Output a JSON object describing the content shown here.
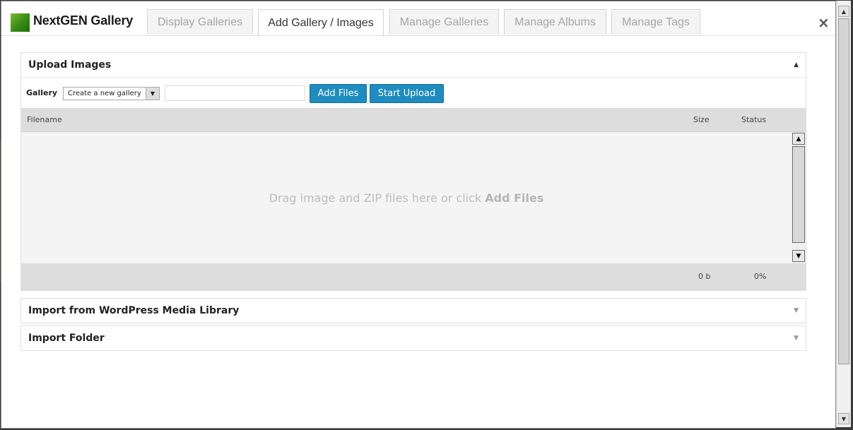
{
  "header": {
    "logo_text": "NextGEN Gallery",
    "close_glyph": "×",
    "tabs": [
      {
        "label": "Display Galleries",
        "active": false
      },
      {
        "label": "Add Gallery / Images",
        "active": true
      },
      {
        "label": "Manage Galleries",
        "active": false
      },
      {
        "label": "Manage Albums",
        "active": false
      },
      {
        "label": "Manage Tags",
        "active": false
      }
    ]
  },
  "upload": {
    "title": "Upload Images",
    "gallery_label": "Gallery",
    "gallery_select_value": "Create a new gallery",
    "gallery_name_value": "",
    "add_files_label": "Add Files",
    "start_upload_label": "Start Upload",
    "columns": {
      "filename": "Filename",
      "size": "Size",
      "status": "Status"
    },
    "drop_text": "Drag image and ZIP files here or click ",
    "drop_text_bold": "Add Files",
    "total_size": "0 b",
    "total_percent": "0%"
  },
  "sections": [
    {
      "title": "Import from WordPress Media Library"
    },
    {
      "title": "Import Folder"
    }
  ],
  "colors": {
    "accent": "#1e8cbe",
    "logo_green": "#3b8f14"
  },
  "icons": {
    "collapse": "triangle-up-icon",
    "expand": "triangle-down-icon",
    "close": "close-icon"
  }
}
